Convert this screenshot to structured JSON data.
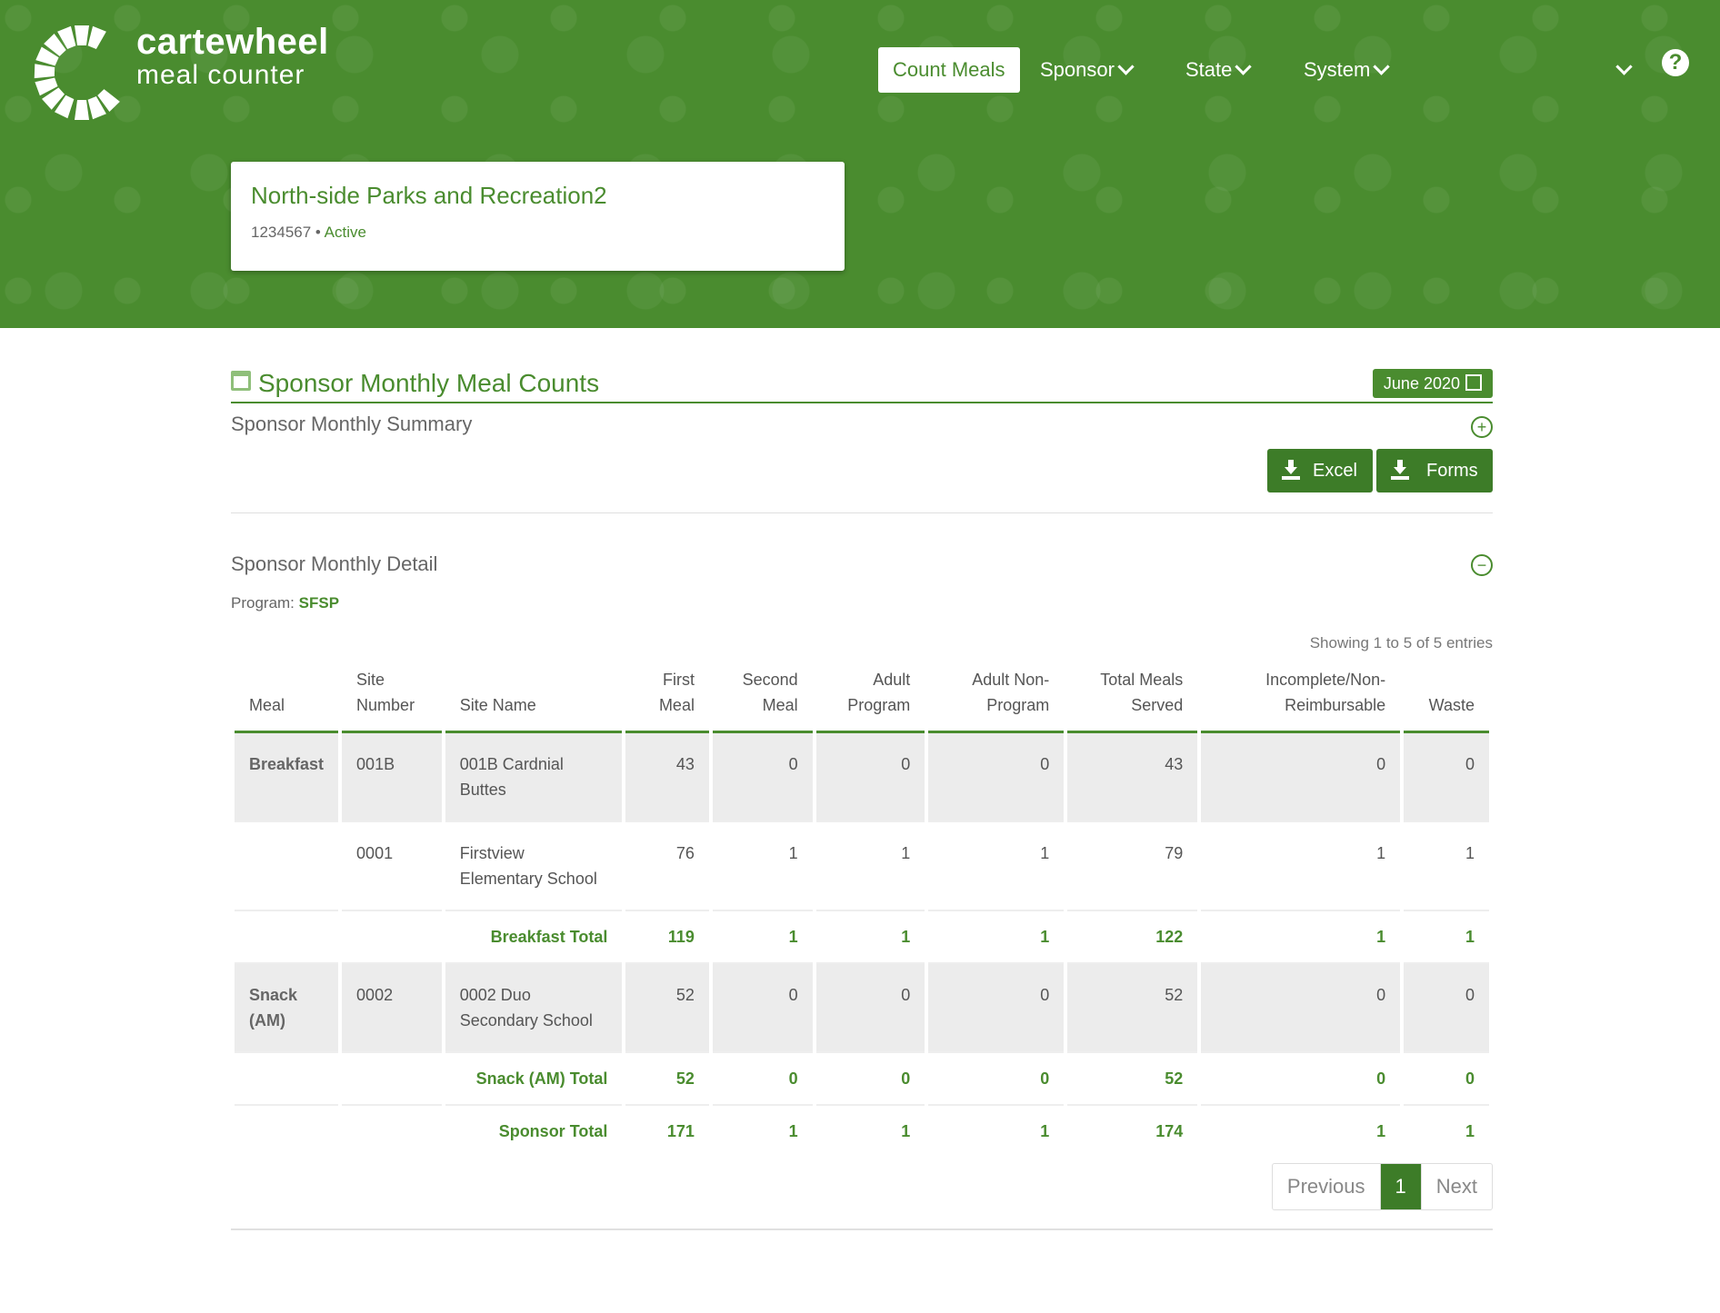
{
  "header": {
    "brand_line1": "cartewheel",
    "brand_line2": "meal counter",
    "nav": [
      {
        "label": "Count Meals"
      },
      {
        "label": "Sponsor"
      },
      {
        "label": "State"
      },
      {
        "label": "System"
      }
    ],
    "help_symbol": "?"
  },
  "sponsor_card": {
    "name": "North-side Parks and Recreation2",
    "id": "1234567",
    "separator": "•",
    "status": "Active"
  },
  "page": {
    "title": "Sponsor Monthly Meal Counts",
    "month": "June 2020",
    "summary_heading": "Sponsor Monthly Summary",
    "summary_toggle": "+",
    "excel_label": "Excel",
    "forms_label": "Forms",
    "detail_heading": "Sponsor Monthly Detail",
    "detail_toggle": "−",
    "program_label": "Program:",
    "program_value": "SFSP",
    "showing": "Showing 1 to 5 of 5 entries"
  },
  "table": {
    "headers": [
      "Meal",
      "Site Number",
      "Site Name",
      "First Meal",
      "Second Meal",
      "Adult Program",
      "Adult Non-Program",
      "Total Meals Served",
      "Incomplete/Non-Reimbursable",
      "Waste"
    ],
    "rows": [
      {
        "meal": "Breakfast",
        "site_number": "001B",
        "site_name": "001B Cardnial Buttes",
        "first": "43",
        "second": "0",
        "adult": "0",
        "adult_non": "0",
        "total": "43",
        "incomplete": "0",
        "waste": "0"
      },
      {
        "meal": "",
        "site_number": "0001",
        "site_name": "Firstview Elementary School",
        "first": "76",
        "second": "1",
        "adult": "1",
        "adult_non": "1",
        "total": "79",
        "incomplete": "1",
        "waste": "1"
      },
      {
        "label": "Breakfast Total",
        "first": "119",
        "second": "1",
        "adult": "1",
        "adult_non": "1",
        "total": "122",
        "incomplete": "1",
        "waste": "1"
      },
      {
        "meal": "Snack (AM)",
        "site_number": "0002",
        "site_name": "0002 Duo Secondary School",
        "first": "52",
        "second": "0",
        "adult": "0",
        "adult_non": "0",
        "total": "52",
        "incomplete": "0",
        "waste": "0"
      },
      {
        "label": "Snack (AM) Total",
        "first": "52",
        "second": "0",
        "adult": "0",
        "adult_non": "0",
        "total": "52",
        "incomplete": "0",
        "waste": "0"
      },
      {
        "label": "Sponsor Total",
        "first": "171",
        "second": "1",
        "adult": "1",
        "adult_non": "1",
        "total": "174",
        "incomplete": "1",
        "waste": "1"
      }
    ]
  },
  "pagination": {
    "previous": "Previous",
    "current": "1",
    "next": "Next"
  },
  "colors": {
    "brand_green": "#4a8c2f",
    "button_green": "#3d7c28"
  }
}
